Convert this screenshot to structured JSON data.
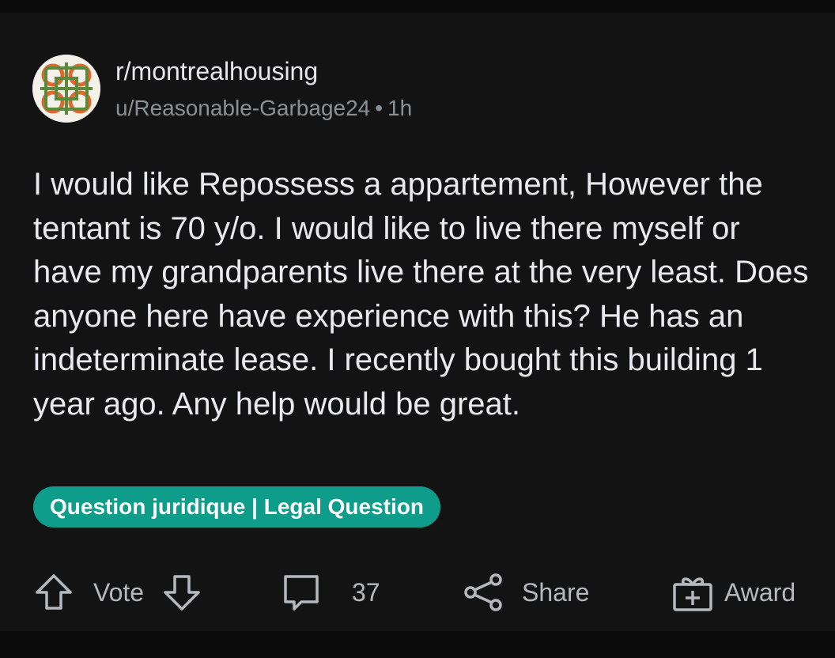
{
  "post": {
    "subreddit": "r/montrealhousing",
    "author": "u/Reasonable-Garbage24",
    "separator": "•",
    "time_ago": "1h",
    "title": "I would like Repossess a appartement, However the tentant is 70 y/o. I would like to live there myself or have my grandparents live there at the very least. Does anyone here have experience with this? He has an indeterminate lease. I recently bought this building 1 year ago. Any help would be great.",
    "flair": "Question juridique | Legal Question",
    "flair_color": "#0e9d8a"
  },
  "actions": {
    "vote_label": "Vote",
    "comment_count": "37",
    "share_label": "Share",
    "award_label": "Award"
  },
  "icons": {
    "avatar": "subreddit-logo-icon",
    "upvote": "arrow-up-icon",
    "downvote": "arrow-down-icon",
    "comment": "comment-bubble-icon",
    "share": "share-icon",
    "award": "gift-icon"
  },
  "colors": {
    "background": "#131313",
    "text_primary": "#e8eaed",
    "text_secondary": "#8b9094",
    "action_text": "#b5b9bd"
  }
}
